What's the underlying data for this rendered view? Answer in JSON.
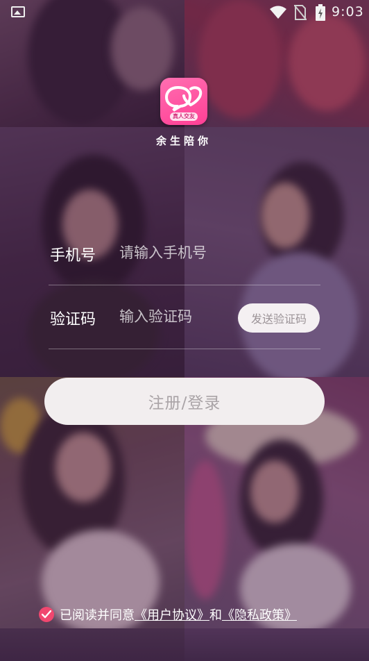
{
  "status_bar": {
    "time": "9:03"
  },
  "app": {
    "name": "余生陪你",
    "logo_tag": "真人交友"
  },
  "form": {
    "phone_label": "手机号",
    "phone_placeholder": "请输入手机号",
    "code_label": "验证码",
    "code_placeholder": "输入验证码",
    "send_code_label": "发送验证码",
    "submit_label": "注册/登录"
  },
  "agreement": {
    "prefix": "已阅读并同意",
    "user_agreement": "《用户协议》",
    "conjunction": "和",
    "privacy_policy": "《隐私政策》",
    "checked": true
  },
  "colors": {
    "accent": "#f0476f",
    "logo": "#ff4f9f",
    "overlay": "#461e46"
  }
}
